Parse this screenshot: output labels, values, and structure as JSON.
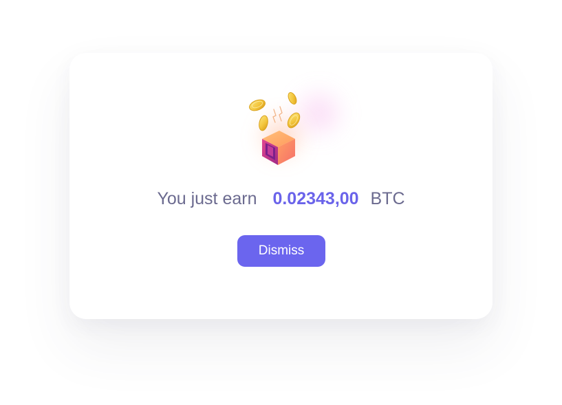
{
  "dialog": {
    "message_prefix": "You just earn",
    "amount": "0.02343,00",
    "currency": "BTC",
    "dismiss_label": "Dismiss",
    "illustration_icon": "reward-box-with-coins-icon"
  },
  "colors": {
    "accent": "#6a63ea",
    "text": "#6b6a8f",
    "button": "#6b65ee",
    "card": "#ffffff"
  }
}
